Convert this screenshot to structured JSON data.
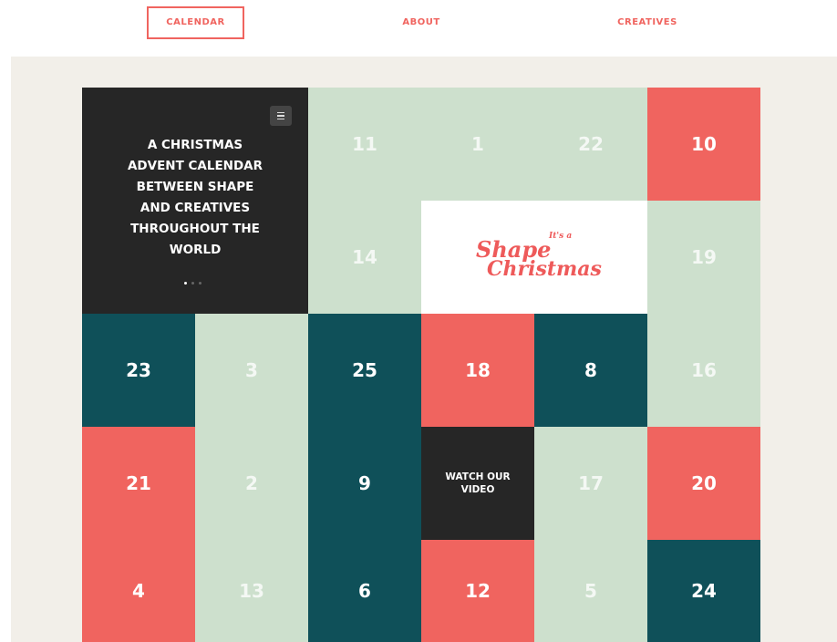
{
  "nav": {
    "items": [
      {
        "label": "CALENDAR",
        "active": true
      },
      {
        "label": "ABOUT",
        "active": false
      },
      {
        "label": "CREATIVES",
        "active": false
      }
    ]
  },
  "intro": {
    "lines": [
      "A CHRISTMAS",
      "ADVENT CALENDAR",
      "BETWEEN SHAPE",
      "AND CREATIVES",
      "THROUGHOUT THE",
      "WORLD"
    ],
    "menu_icon": "hamburger-icon",
    "carousel": {
      "count": 3,
      "active": 1
    }
  },
  "logo": {
    "small": "It's a",
    "line1": "Shape",
    "line2": "Christmas"
  },
  "watch_video": "WATCH OUR VIDEO",
  "colors": {
    "dark": "#262626",
    "mint": "#cde0cd",
    "coral": "#f0645f",
    "teal": "#0f5059",
    "background": "#f2efe9",
    "accent": "#f0645f"
  },
  "days": [
    {
      "number": "11",
      "color": "mint"
    },
    {
      "number": "1",
      "color": "mint"
    },
    {
      "number": "22",
      "color": "mint"
    },
    {
      "number": "10",
      "color": "coral"
    },
    {
      "number": "14",
      "color": "mint"
    },
    {
      "number": "19",
      "color": "mint"
    },
    {
      "number": "23",
      "color": "teal"
    },
    {
      "number": "3",
      "color": "mint"
    },
    {
      "number": "25",
      "color": "teal"
    },
    {
      "number": "18",
      "color": "coral"
    },
    {
      "number": "8",
      "color": "teal"
    },
    {
      "number": "16",
      "color": "mint"
    },
    {
      "number": "21",
      "color": "coral"
    },
    {
      "number": "2",
      "color": "mint"
    },
    {
      "number": "9",
      "color": "teal"
    },
    {
      "number": "17",
      "color": "mint"
    },
    {
      "number": "20",
      "color": "coral"
    },
    {
      "number": "4",
      "color": "coral"
    },
    {
      "number": "13",
      "color": "mint"
    },
    {
      "number": "6",
      "color": "teal"
    },
    {
      "number": "12",
      "color": "coral"
    },
    {
      "number": "5",
      "color": "mint"
    },
    {
      "number": "24",
      "color": "teal"
    }
  ]
}
